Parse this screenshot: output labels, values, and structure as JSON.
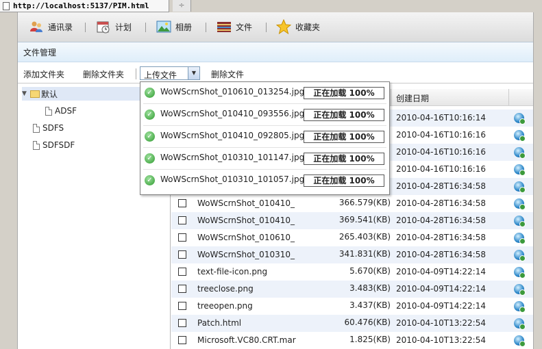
{
  "browser": {
    "tab_title": "http://localhost:5137/PIM.html",
    "new_tab": "÷"
  },
  "nav": [
    {
      "label": "通讯录",
      "icon": "contacts-icon"
    },
    {
      "label": "计划",
      "icon": "calendar-icon"
    },
    {
      "label": "相册",
      "icon": "photo-icon"
    },
    {
      "label": "文件",
      "icon": "archive-icon"
    },
    {
      "label": "收藏夹",
      "icon": "star-icon"
    }
  ],
  "section_title": "文件管理",
  "toolbar": {
    "add_folder": "添加文件夹",
    "delete_folder": "删除文件夹",
    "upload": "上传文件",
    "delete_file": "删除文件"
  },
  "tree": {
    "root": "默认",
    "children": [
      "ADSF"
    ],
    "siblings": [
      "SDFS",
      "SDFSDF"
    ]
  },
  "grid": {
    "headers": {
      "created": "创建日期"
    },
    "rows": [
      {
        "name": "",
        "size": "",
        "date": "2010-04-16T10:16:14"
      },
      {
        "name": "",
        "size": "",
        "date": "2010-04-16T10:16:16"
      },
      {
        "name": "",
        "size": "",
        "date": "2010-04-16T10:16:16"
      },
      {
        "name": "",
        "size": "",
        "date": "2010-04-16T10:16:16"
      },
      {
        "name": "",
        "size": "",
        "date": "2010-04-28T16:34:58"
      },
      {
        "name": "WoWScrnShot_010410_",
        "size": "366.579(KB)",
        "date": "2010-04-28T16:34:58"
      },
      {
        "name": "WoWScrnShot_010410_",
        "size": "369.541(KB)",
        "date": "2010-04-28T16:34:58"
      },
      {
        "name": "WoWScrnShot_010610_",
        "size": "265.403(KB)",
        "date": "2010-04-28T16:34:58"
      },
      {
        "name": "WoWScrnShot_010310_",
        "size": "341.831(KB)",
        "date": "2010-04-28T16:34:58"
      },
      {
        "name": "text-file-icon.png",
        "size": "5.670(KB)",
        "date": "2010-04-09T14:22:14"
      },
      {
        "name": "treeclose.png",
        "size": "3.483(KB)",
        "date": "2010-04-09T14:22:14"
      },
      {
        "name": "treeopen.png",
        "size": "3.437(KB)",
        "date": "2010-04-09T14:22:14"
      },
      {
        "name": "Patch.html",
        "size": "60.476(KB)",
        "date": "2010-04-10T13:22:54"
      },
      {
        "name": "Microsoft.VC80.CRT.mar",
        "size": "1.825(KB)",
        "date": "2010-04-10T13:22:54"
      }
    ]
  },
  "uploads": [
    {
      "file": "WoWScrnShot_010610_013254.jpg",
      "status": "正在加载 100%"
    },
    {
      "file": "WoWScrnShot_010410_093556.jpg",
      "status": "正在加载 100%"
    },
    {
      "file": "WoWScrnShot_010410_092805.jpg",
      "status": "正在加载 100%"
    },
    {
      "file": "WoWScrnShot_010310_101147.jpg",
      "status": "正在加载 100%"
    },
    {
      "file": "WoWScrnShot_010310_101057.jpg",
      "status": "正在加载 100%"
    }
  ]
}
